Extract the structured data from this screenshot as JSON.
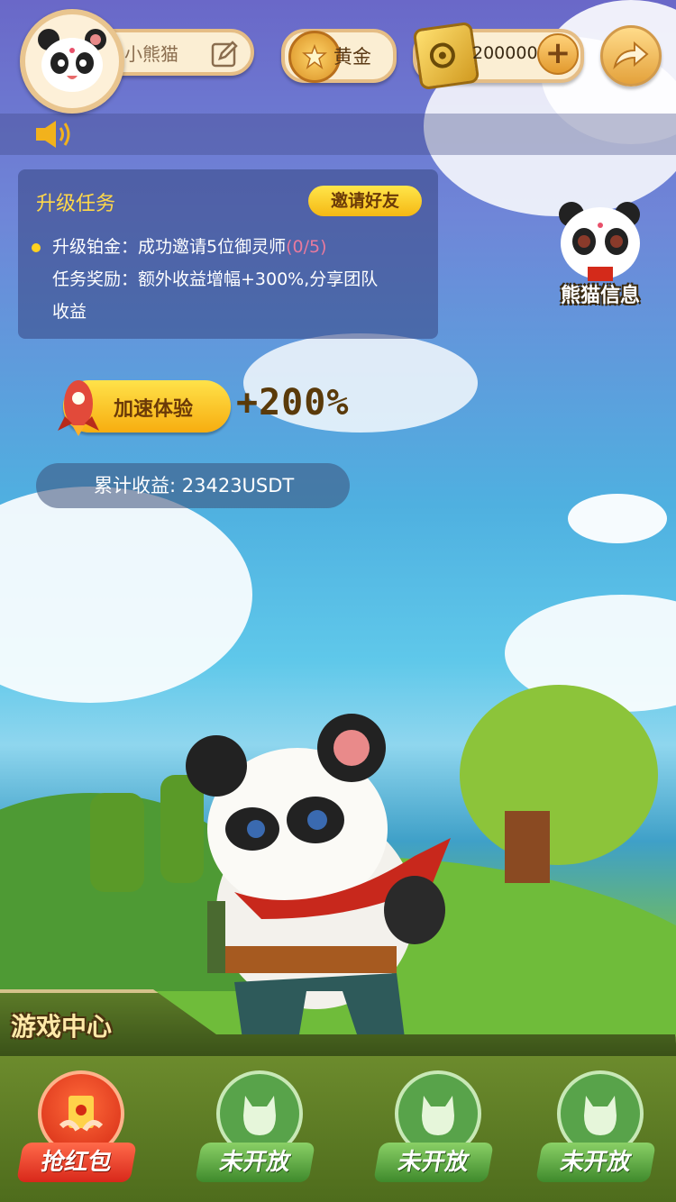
{
  "header": {
    "username": "小熊猫",
    "rank_label": "黄金",
    "coins": "200000"
  },
  "task": {
    "title": "升级任务",
    "invite_label": "邀请好友",
    "upgrade_prefix": "升级铂金：",
    "upgrade_text": "成功邀请5位御灵师",
    "progress": "(0/5)",
    "reward_line1": "任务奖励：额外收益增幅+300%,分享团队",
    "reward_line2": "收益"
  },
  "panda_info": {
    "label": "熊猫信息"
  },
  "boost": {
    "label": "加速体验",
    "value": "+200%"
  },
  "earnings": {
    "text": "累计收益: 23423USDT"
  },
  "game_center": {
    "title": "游戏中心",
    "items": [
      {
        "label": "抢红包"
      },
      {
        "label": "未开放"
      },
      {
        "label": "未开放"
      },
      {
        "label": "未开放"
      }
    ]
  },
  "colors": {
    "accent_yellow": "#ffd84a",
    "progress_pink": "#e87a9e",
    "game_green": "#3f8a2c",
    "game_red": "#d8281a"
  }
}
